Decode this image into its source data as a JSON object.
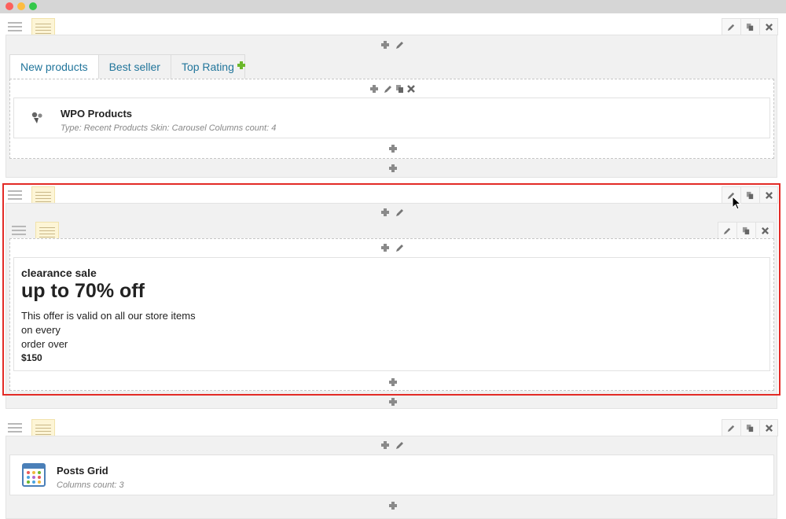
{
  "window": {
    "controls": [
      "close",
      "minimize",
      "zoom"
    ]
  },
  "tabs": [
    {
      "label": "New products",
      "active": true
    },
    {
      "label": "Best seller",
      "active": false
    },
    {
      "label": "Top Rating",
      "active": false
    }
  ],
  "wpo_widget": {
    "title": "WPO Products",
    "meta": "Type: Recent Products  Skin: Carousel  Columns count: 4",
    "icon": "wpo-products-icon"
  },
  "promo_widget": {
    "small_title": "clearance sale",
    "headline": "up to 70% off",
    "lines": [
      "This offer is valid on all our store items",
      "on every",
      "order over"
    ],
    "price": "$150"
  },
  "posts_widget": {
    "title": "Posts Grid",
    "meta": "Columns count: 3",
    "icon": "posts-grid-icon"
  },
  "toolbar_icons": [
    "pencil-icon",
    "copy-icon",
    "close-icon"
  ],
  "colors": {
    "selection_border": "#e32b26",
    "tab_link": "#21759b",
    "add_tab": "#6cb82b"
  }
}
